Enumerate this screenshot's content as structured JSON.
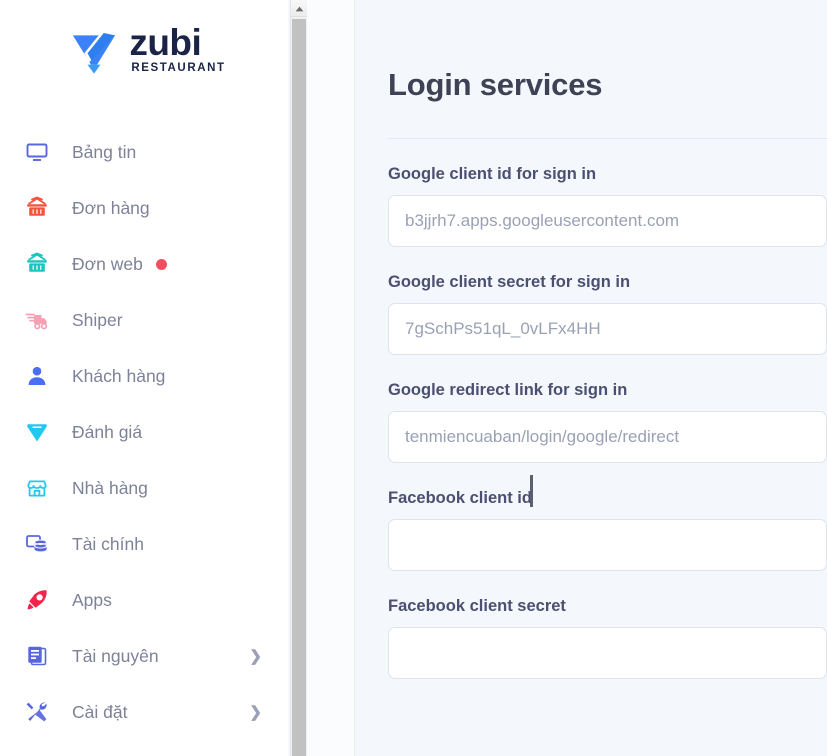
{
  "brand": {
    "name": "zubi",
    "tagline": "RESTAURANT",
    "logo_icon": "diamond-z-logo-icon",
    "mark_color": "#2f7ef0",
    "text_color": "#1b2447"
  },
  "sidebar": {
    "items": [
      {
        "label": "Bảng tin",
        "icon": "monitor-icon",
        "color": "#5867dd",
        "badge": false,
        "chevron": false
      },
      {
        "label": "Đơn hàng",
        "icon": "shopping-basket-icon",
        "color": "#f4543c",
        "badge": false,
        "chevron": false
      },
      {
        "label": "Đơn web",
        "icon": "shopping-basket-icon",
        "color": "#1bc5bd",
        "badge": true,
        "chevron": false
      },
      {
        "label": "Shiper",
        "icon": "delivery-truck-icon",
        "color": "#f5a0b5",
        "badge": false,
        "chevron": false
      },
      {
        "label": "Khách hàng",
        "icon": "user-icon",
        "color": "#4c6ef5",
        "badge": false,
        "chevron": false
      },
      {
        "label": "Đánh giá",
        "icon": "diamond-icon",
        "color": "#23c8f2",
        "badge": false,
        "chevron": false
      },
      {
        "label": "Nhà hàng",
        "icon": "storefront-icon",
        "color": "#23c8f2",
        "badge": false,
        "chevron": false
      },
      {
        "label": "Tài chính",
        "icon": "database-coins-icon",
        "color": "#5867dd",
        "badge": false,
        "chevron": false
      },
      {
        "label": "Apps",
        "icon": "rocket-icon",
        "color": "#f0254b",
        "badge": false,
        "chevron": false
      },
      {
        "label": "Tài nguyên",
        "icon": "document-list-icon",
        "color": "#5867dd",
        "badge": false,
        "chevron": true
      },
      {
        "label": "Cài đặt",
        "icon": "tools-icon",
        "color": "#5867dd",
        "badge": false,
        "chevron": true
      }
    ],
    "chevron_glyph": "❯",
    "badge_color": "#f64e60"
  },
  "scrollbar": {
    "up_arrow_icon": "chevron-up-icon",
    "thumb_color": "#c1c1c1",
    "track_color": "#f1f1f1"
  },
  "main": {
    "title": "Login services",
    "fields": [
      {
        "label": "Google client id for sign in",
        "value": "",
        "placeholder": "b3jjrh7.apps.googleusercontent.com"
      },
      {
        "label": "Google client secret for sign in",
        "value": "",
        "placeholder": "7gSchPs51qL_0vLFx4HH"
      },
      {
        "label": "Google redirect link for sign in",
        "value": "",
        "placeholder": "tenmiencuaban/login/google/redirect"
      },
      {
        "label": "Facebook client id",
        "value": "",
        "placeholder": ""
      },
      {
        "label": "Facebook client secret",
        "value": "",
        "placeholder": ""
      }
    ]
  },
  "cursor": {
    "type": "text-ibeam-cursor"
  }
}
